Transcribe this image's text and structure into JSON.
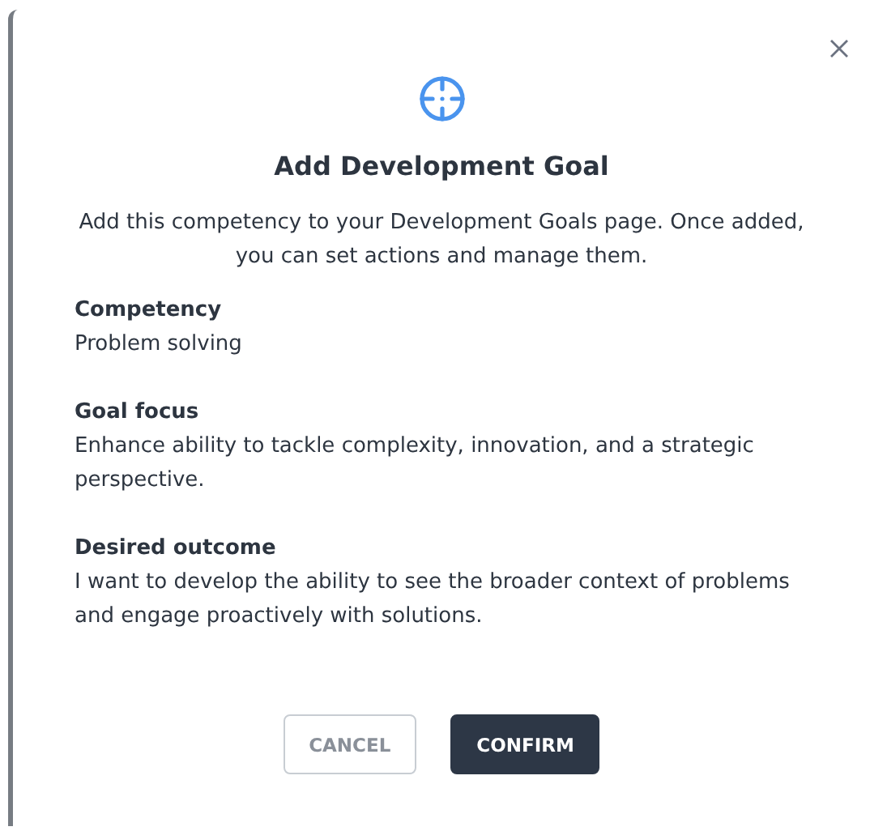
{
  "dialog": {
    "title": "Add Development Goal",
    "description": "Add this competency to your Development Goals page. Once added, you can set actions and manage them.",
    "fields": [
      {
        "label": "Competency",
        "value": "Problem solving"
      },
      {
        "label": "Goal focus",
        "value": "Enhance ability to tackle complexity, innovation, and a strategic perspective."
      },
      {
        "label": "Desired outcome",
        "value": "I want to develop the ability to see the broader context of problems and engage proactively with solutions."
      }
    ],
    "buttons": [
      {
        "label": "CANCEL",
        "kind": "secondary"
      },
      {
        "label": "CONFIRM",
        "kind": "primary"
      }
    ]
  }
}
